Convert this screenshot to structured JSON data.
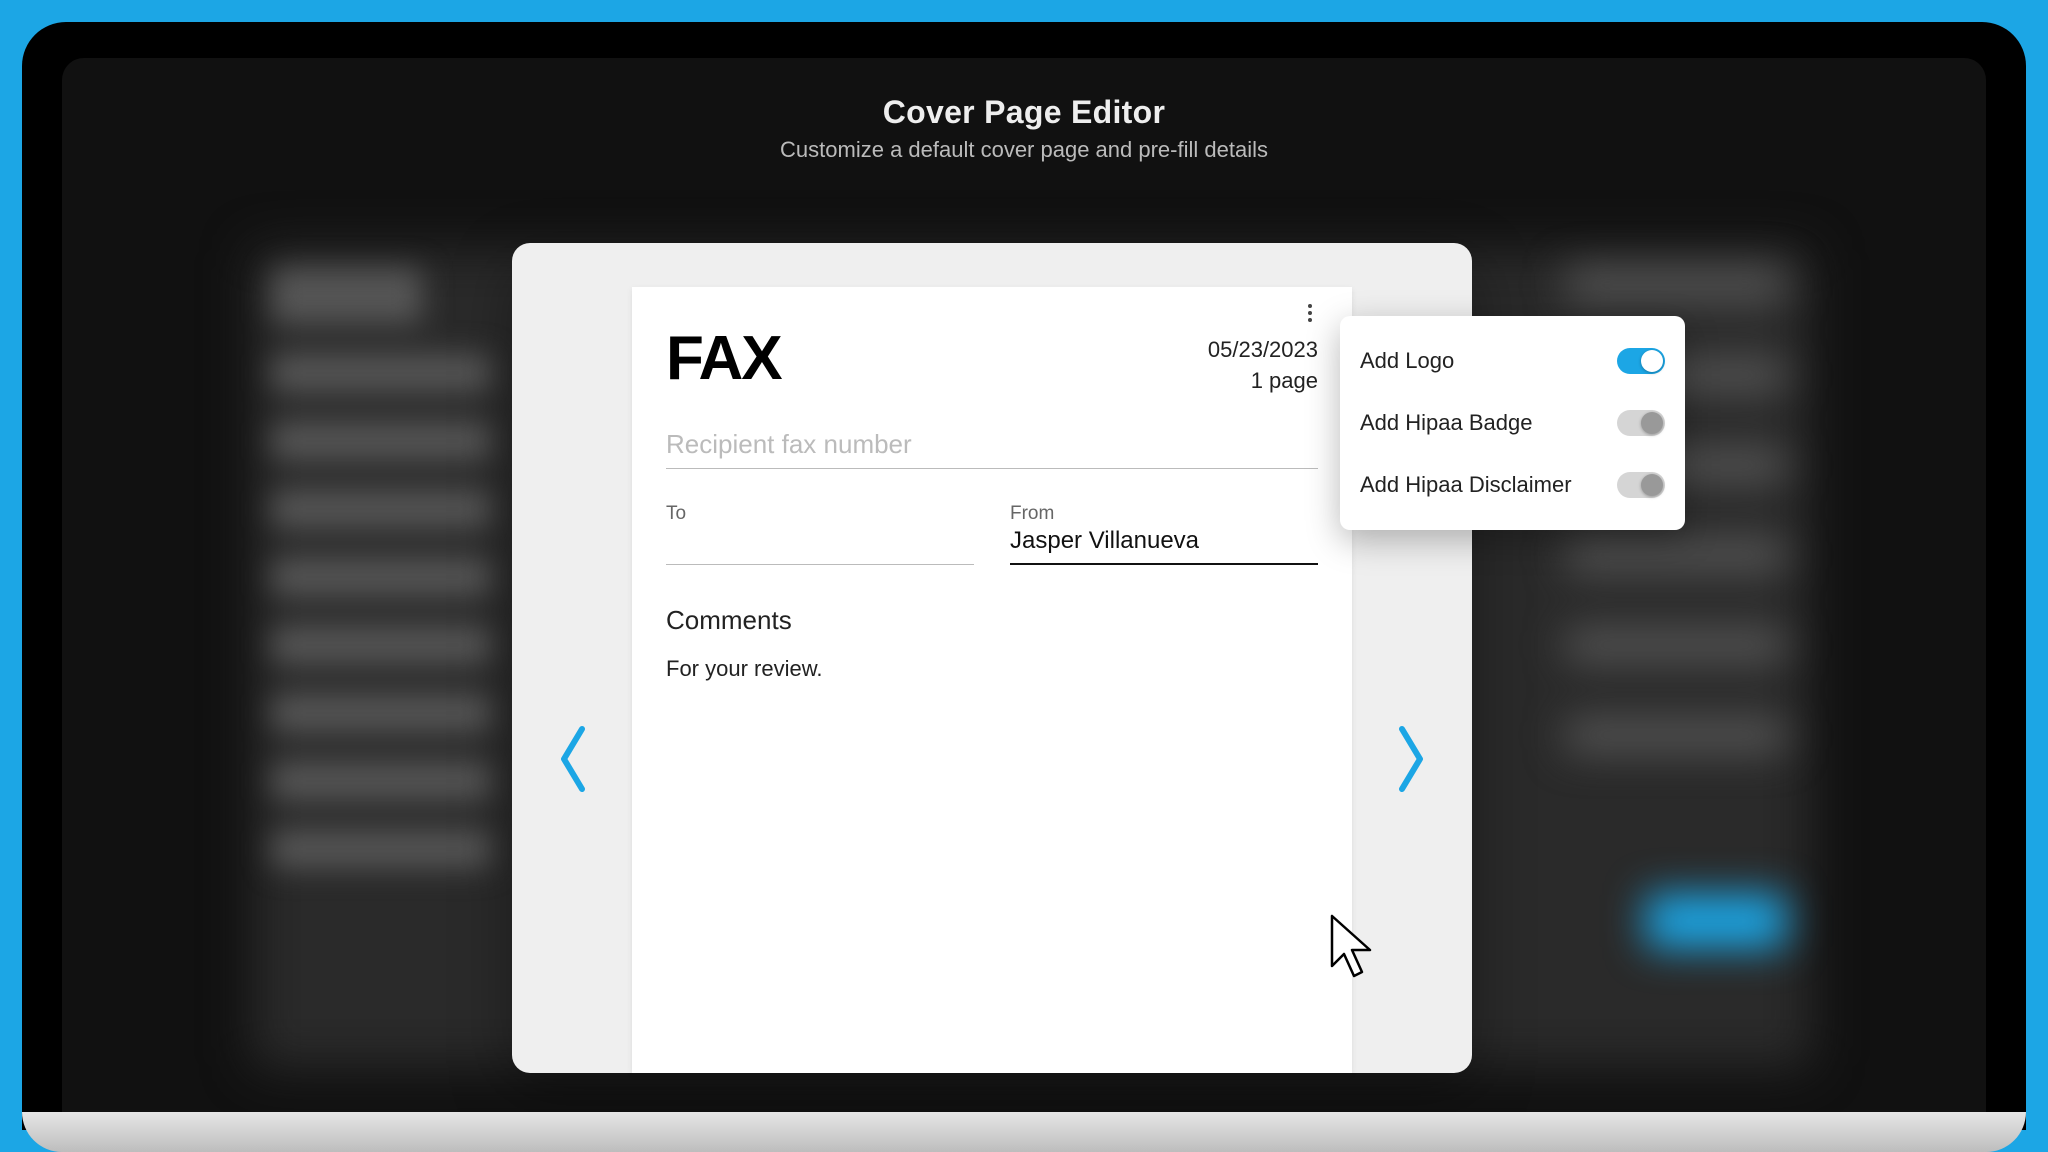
{
  "header": {
    "title": "Cover Page Editor",
    "subtitle": "Customize a default cover page and pre-fill details"
  },
  "page": {
    "logo": "FAX",
    "date": "05/23/2023",
    "page_count": "1 page",
    "recipient_placeholder": "Recipient fax number",
    "to_label": "To",
    "to_value": "",
    "from_label": "From",
    "from_value": "Jasper Villanueva",
    "comments_label": "Comments",
    "comments_text": "For your review."
  },
  "options": [
    {
      "label": "Add Logo",
      "on": true
    },
    {
      "label": "Add Hipaa Badge",
      "on": false
    },
    {
      "label": "Add Hipaa Disclaimer",
      "on": false
    }
  ],
  "icons": {
    "more": "more-vertical-icon",
    "chevron_left": "chevron-left-icon",
    "chevron_right": "chevron-right-icon",
    "cursor": "cursor-icon"
  }
}
